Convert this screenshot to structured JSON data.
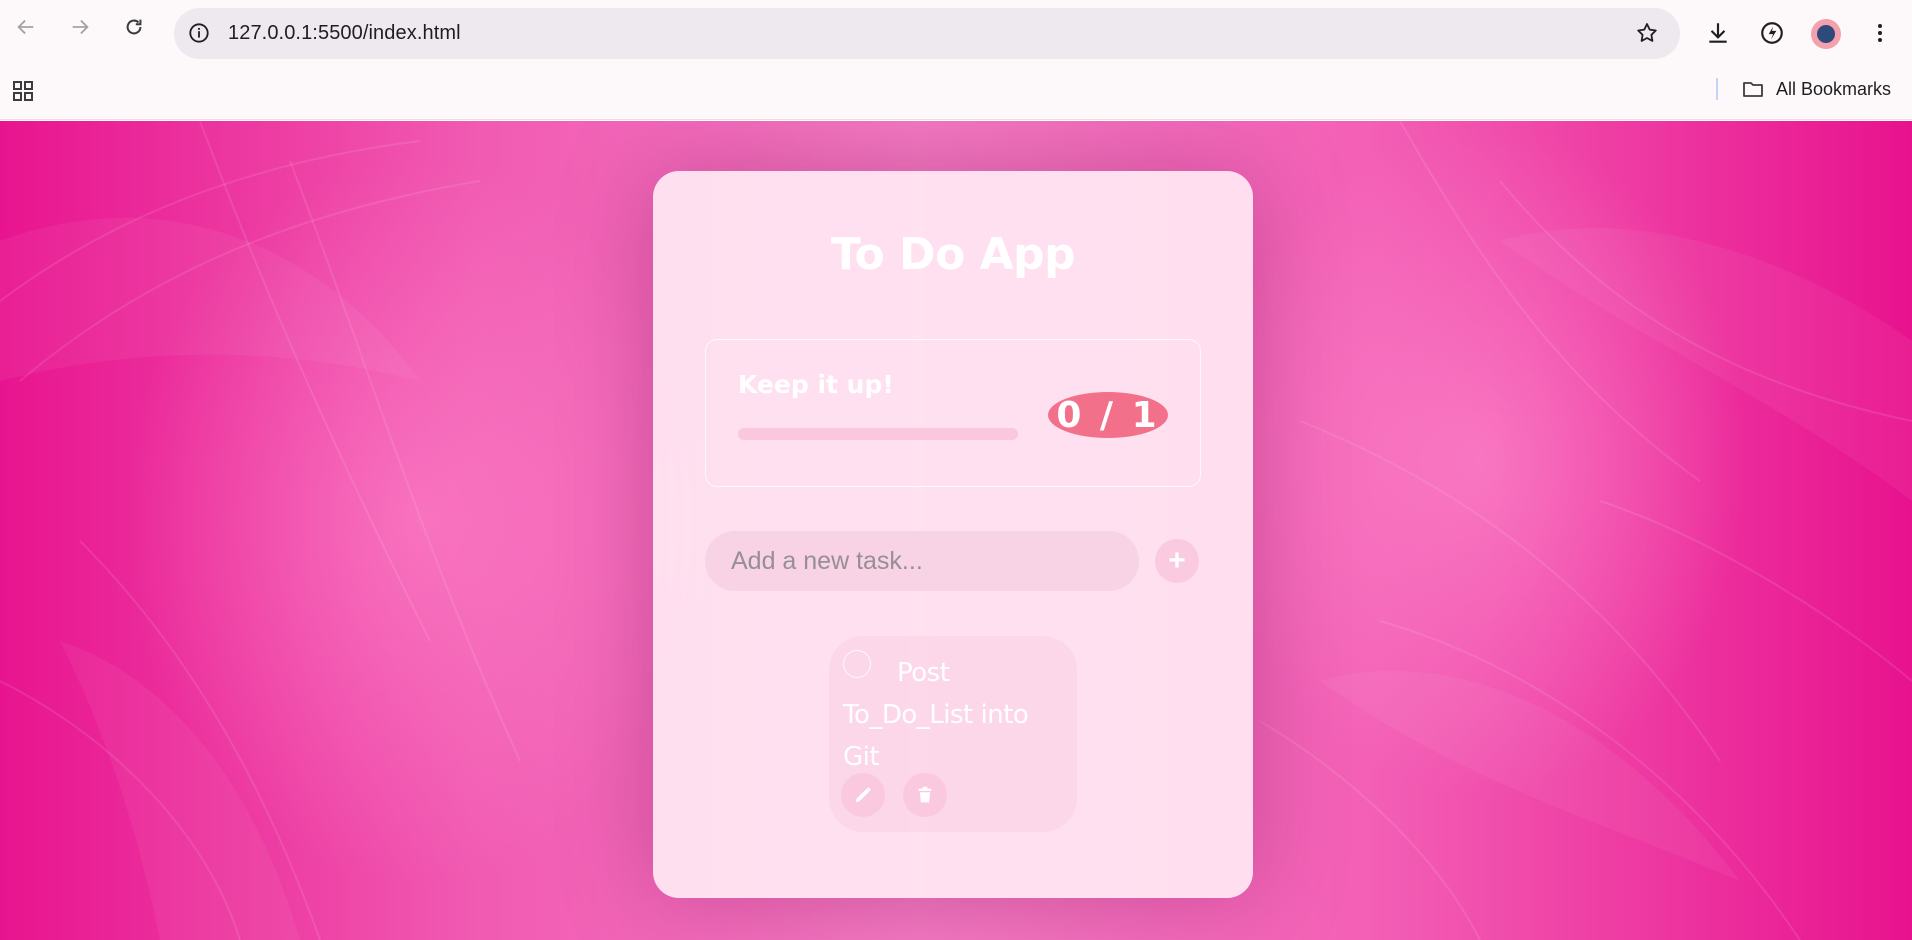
{
  "browser": {
    "url": "127.0.0.1:5500/index.html",
    "all_bookmarks_label": "All Bookmarks",
    "icons": [
      "back-arrow-icon",
      "forward-arrow-icon",
      "reload-icon",
      "site-info-icon",
      "bookmark-star-icon",
      "download-icon",
      "performance-icon",
      "profile-avatar",
      "more-menu-icon",
      "apps-grid-icon",
      "folder-icon"
    ]
  },
  "app": {
    "title": "To Do App",
    "stats": {
      "message": "Keep it up!",
      "counter_text": "0 / 1",
      "completed": 0,
      "total": 1,
      "progress_fraction": 0
    },
    "input": {
      "placeholder": "Add a new task...",
      "value": "",
      "add_label": "+"
    },
    "tasks": [
      {
        "text": "Post To_Do_List into Git",
        "completed": false
      }
    ]
  },
  "colors": {
    "background_magenta": "#e8148f",
    "counter_badge": "#f27089",
    "card": "#ffe8f3"
  }
}
